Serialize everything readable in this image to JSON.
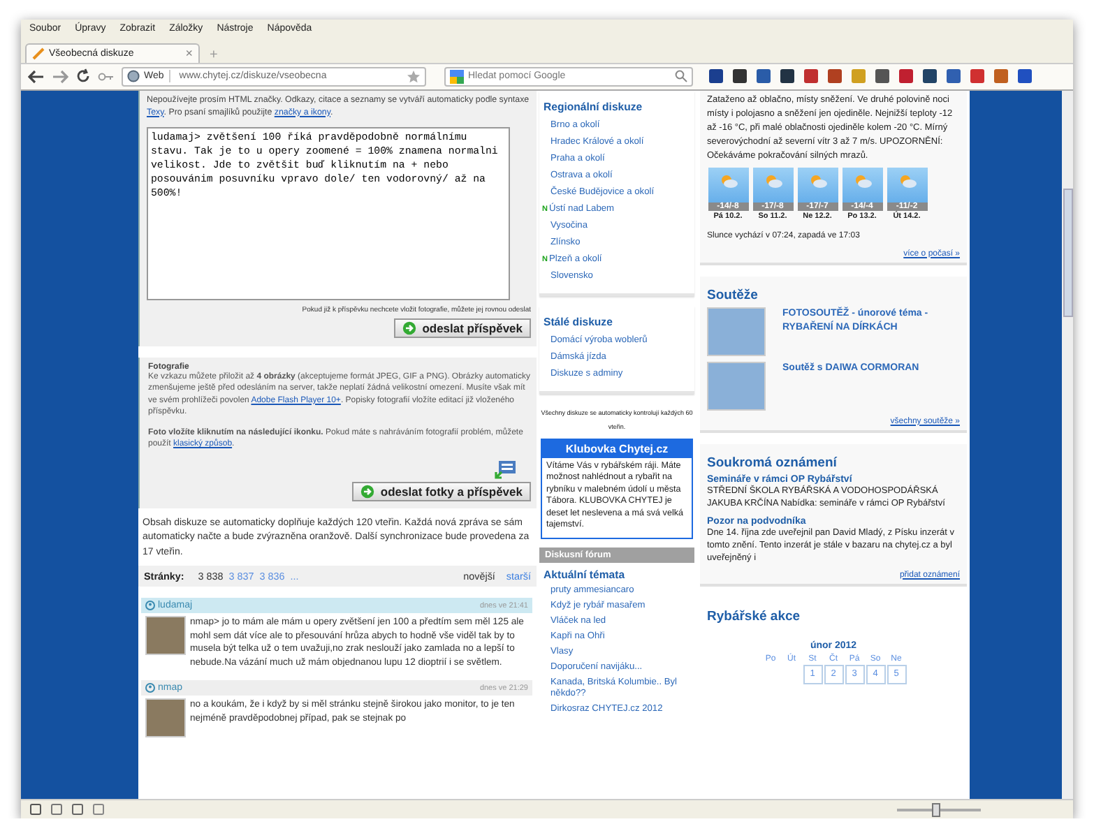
{
  "menu": [
    "Soubor",
    "Úpravy",
    "Zobrazit",
    "Záložky",
    "Nástroje",
    "Nápověda"
  ],
  "tabs": [
    {
      "label": "Všeobecná diskuze",
      "close": "×",
      "selected": true
    }
  ],
  "new_tab": "+",
  "navbar": {
    "identity": "Web",
    "url": "www.chytej.cz/diskuze/vseobecna",
    "search_placeholder": "Hledat pomocí Google"
  },
  "content": {
    "syntax_note": [
      {
        "kind": "text",
        "text": "Nepoužívejte prosím HTML značky. Odkazy, citace a seznamy se vytváří automaticky podle syntaxe "
      },
      {
        "kind": "link",
        "text": "Texy"
      },
      {
        "kind": "text",
        "text": ". Pro psaní smajlíků použijte "
      },
      {
        "kind": "link",
        "text": "značky a ikony"
      },
      {
        "kind": "text",
        "text": "."
      }
    ],
    "message": "ludamaj> zvětšení 100 říká pravděpodobně normálnímu stavu. Tak je to u opery zoomené = 100% znamena normalni velikost. Jde to zvětšit buď kliknutím na + nebo posouvánim posuvníku vpravo dole/ ten vodorovný/ až na 500%!",
    "hint": "Pokud již k příspěvku nechcete vložit fotografie, můžete jej rovnou odeslat",
    "send_button": "odeslat příspěvek",
    "photos": {
      "title": "Fotografie",
      "paragraphs": [
        [
          {
            "kind": "text",
            "text": "Ke vzkazu můžete přiložit až **4 obrázky** (akceptujeme formát JPEG, GIF a PNG). Obrázky automaticky zmenšujeme ještě před odesláním na server, takže neplatí žádná velikostní omezení. Musíte však mít ve svém prohlížeči povolen "
          },
          {
            "kind": "link",
            "text": "Adobe Flash Player 10+"
          },
          {
            "kind": "text",
            "text": ". Popisky fotografií vložíte editací již vloženého příspěvku."
          }
        ],
        [
          {
            "kind": "text",
            "text": "**Foto vložíte kliknutím na následující ikonku.** Pokud máte s nahráváním fotografií problém, můžete použít "
          },
          {
            "kind": "link",
            "text": "klasický způsob"
          },
          {
            "kind": "text",
            "text": "."
          }
        ]
      ],
      "button": "odeslat fotky a příspěvek"
    },
    "sync_note": "Obsah diskuze se automaticky doplňuje každých 120 vteřin. Každá nová zpráva se sám automaticky načte a bude zvýrazněna oranžově. Další synchronizace bude provedena za 17 vteřin.",
    "pager": {
      "label": "Stránky:",
      "pages": [
        {
          "label": "3 838",
          "selected": true
        },
        {
          "label": "3 837",
          "selected": false
        },
        {
          "label": "3 836",
          "selected": false
        }
      ],
      "more": "...",
      "newer": "novější",
      "older": "starší"
    },
    "posts": [
      {
        "author": "ludamaj",
        "time": "dnes ve 21:41",
        "highlighted": true,
        "text": "nmap> jo to mám ale mám u opery zvětšení jen 100 a předtím sem měl 125 ale mohl sem dát více ale to přesouvání hrůza abych to hodně vše viděl tak by to musela být telka už o tem uvažuji,no zrak neslouží jako zamlada no a lepší to nebude.Na vázání much už mám objednanou lupu 12 dioptrií i se světlem."
      },
      {
        "author": "nmap",
        "time": "dnes ve 21:29",
        "highlighted": false,
        "text": "no a koukám, že i když by si měl stránku stejně širokou jako monitor, to je ten nejméně pravděpodobnej případ, pak se stejnak po"
      }
    ]
  },
  "middle": {
    "regional": {
      "title": "Regionální diskuze",
      "items": [
        {
          "label": "Brno a okolí"
        },
        {
          "label": "Hradec Králové a okolí"
        },
        {
          "label": "Praha a okolí"
        },
        {
          "label": "Ostrava a okolí"
        },
        {
          "label": "České Budějovice a okolí"
        },
        {
          "label": "Ústí nad Labem",
          "badge": "N"
        },
        {
          "label": "Vysočina"
        },
        {
          "label": "Zlínsko"
        },
        {
          "label": "Plzeň a okolí",
          "badge": "N"
        },
        {
          "label": "Slovensko"
        }
      ]
    },
    "permanent": {
      "title": "Stálé diskuze",
      "items": [
        {
          "label": "Domácí výroba woblerů"
        },
        {
          "label": "Dámská jízda"
        },
        {
          "label": "Diskuze s adminy"
        }
      ]
    },
    "note": "Všechny diskuze se automaticky kontrolují každých 60 vteřin.",
    "club": {
      "title": "Klubovka Chytej.cz",
      "text": "Vítáme Vás v rybářském ráji. Máte možnost nahlédnout a rybařit na rybníku v malebném údolí u města Tábora. KLUBOVKA CHYTEJ je deset let neslevena a má svá velká tajemství."
    },
    "forum_bar": "Diskusní fórum",
    "topics": {
      "title": "Aktuální témata",
      "items": [
        "pruty ammesiancaro",
        "Když je rybář masařem",
        "Vláček na led",
        "Kapři na Ohři",
        "Vlasy",
        "Doporučení navijáku...",
        "Kanada, Britská Kolumbie.. Byl někdo??",
        "Dirkosraz CHYTEJ.cz 2012"
      ]
    }
  },
  "right": {
    "weather": {
      "text": "Zataženo až oblačno, místy sněžení. Ve druhé polovině noci místy i polojasno a sněžení jen ojediněle. Nejnižší teploty -12 až -16 °C, při malé oblačnosti ojediněle kolem -20 °C. Mírný severovýchodní až severní vítr 3 až 7 m/s. UPOZORNĚNÍ: Očekáváme pokračování silných mrazů.",
      "days": [
        {
          "temp": "-14/-8",
          "date": "Pá 10.2."
        },
        {
          "temp": "-17/-8",
          "date": "So 11.2."
        },
        {
          "temp": "-17/-7",
          "date": "Ne 12.2."
        },
        {
          "temp": "-14/-4",
          "date": "Po 13.2."
        },
        {
          "temp": "-11/-2",
          "date": "Út 14.2."
        }
      ],
      "sun": "Slunce vychází v 07:24, zapadá ve 17:03",
      "more": "více o počasí »"
    },
    "contests": {
      "title": "Soutěže",
      "items": [
        "FOTOSOUTĚŽ - únorové téma - RYBAŘENÍ NA DÍRKÁCH",
        "Soutěž s DAIWA CORMORAN"
      ],
      "more": "všechny soutěže »"
    },
    "notices": {
      "title": "Soukromá oznámení",
      "items": [
        {
          "title": "Semináře v rámci OP Rybářství",
          "text": "STŘEDNÍ ŠKOLA RYBÁŘSKÁ A VODOHOSPODÁŘSKÁ JAKUBA KRČÍNA Nabídka: semináře v rámci OP Rybářství"
        },
        {
          "title": "Pozor na podvodníka",
          "text": "Dne 14. října zde uveřejnil pan David Mladý, z Písku inzerát v tomto znění. Tento inzerát je stále v bazaru na chytej.cz a byl uveřejněný i"
        }
      ],
      "more": "přidat oznámení"
    },
    "events": {
      "title": "Rybářské akce",
      "month": "únor 2012",
      "columns": [
        {
          "weekday": "Po"
        },
        {
          "weekday": "Út"
        },
        {
          "weekday": "St",
          "day": "1"
        },
        {
          "weekday": "Čt",
          "day": "2"
        },
        {
          "weekday": "Pá",
          "day": "3"
        },
        {
          "weekday": "So",
          "day": "4"
        },
        {
          "weekday": "Ne",
          "day": "5"
        }
      ]
    }
  },
  "status_bar": {
    "zoom": {
      "level": 0.45
    }
  }
}
